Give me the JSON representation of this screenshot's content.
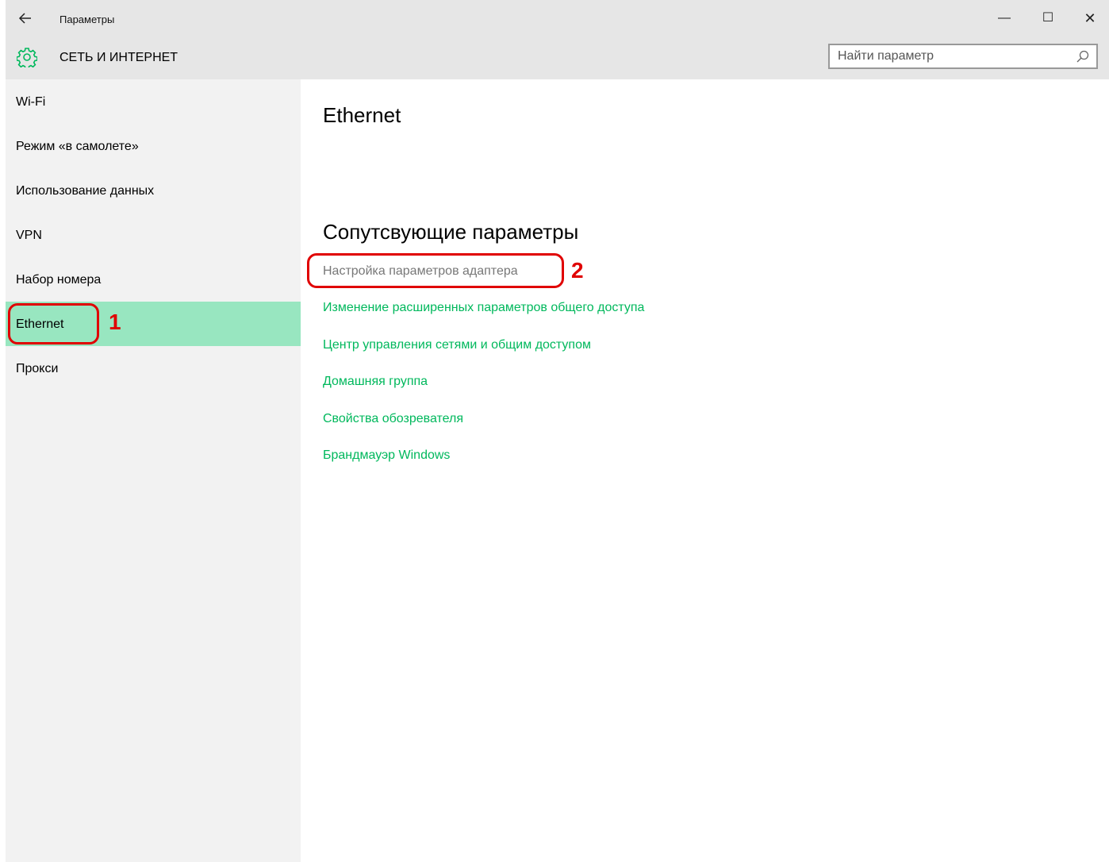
{
  "window": {
    "title": "Параметры",
    "back_icon": "arrow-left-icon",
    "controls": {
      "minimize": "—",
      "maximize": "☐",
      "close": "✕"
    }
  },
  "header": {
    "icon": "gear-icon",
    "section_title": "СЕТЬ И ИНТЕРНЕТ",
    "search_placeholder": "Найти параметр"
  },
  "sidebar": {
    "items": [
      {
        "label": "Wi-Fi"
      },
      {
        "label": "Режим «в самолете»"
      },
      {
        "label": "Использование данных"
      },
      {
        "label": "VPN"
      },
      {
        "label": "Набор номера"
      },
      {
        "label": "Ethernet",
        "selected": true
      },
      {
        "label": "Прокси"
      }
    ]
  },
  "main": {
    "title": "Ethernet",
    "related_title": "Сопутсвующие параметры",
    "links": [
      {
        "label": "Настройка параметров адаптера",
        "state": "disabled"
      },
      {
        "label": "Изменение расширенных параметров общего доступа"
      },
      {
        "label": "Центр управления сетями и общим доступом"
      },
      {
        "label": "Домашняя группа"
      },
      {
        "label": "Свойства обозревателя"
      },
      {
        "label": "Брандмауэр Windows"
      }
    ]
  },
  "annotations": {
    "step1": "1",
    "step2": "2",
    "color": "#e00000"
  },
  "colors": {
    "accent": "#00b85c",
    "selected_bg": "#98e6c0",
    "chrome_bg": "#e6e6e6",
    "sidebar_bg": "#f2f2f2"
  }
}
